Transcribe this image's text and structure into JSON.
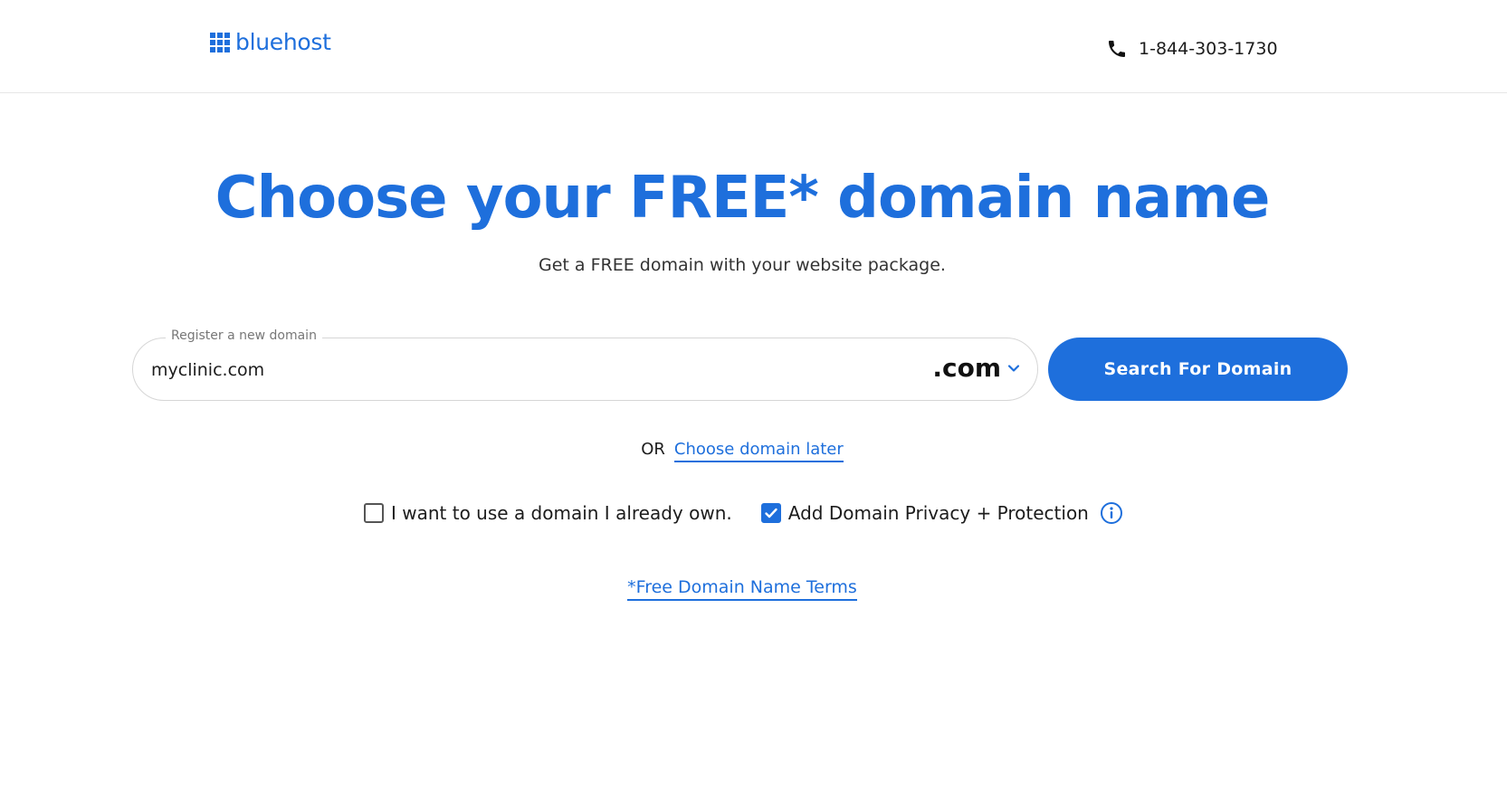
{
  "header": {
    "logo_text": "bluehost",
    "phone": "1-844-303-1730"
  },
  "hero": {
    "title": "Choose your FREE* domain name",
    "subtitle": "Get a FREE domain with your website package."
  },
  "domain_search": {
    "legend": "Register a new domain",
    "value": "myclinic.com",
    "tld": ".com",
    "button_label": "Search For Domain"
  },
  "alternate": {
    "or_text": "OR",
    "link_label": "Choose domain later"
  },
  "options": {
    "own_domain_label": "I want to use a domain I already own.",
    "own_domain_checked": false,
    "privacy_label": "Add Domain Privacy + Protection",
    "privacy_checked": true
  },
  "terms_link": "*Free Domain Name Terms",
  "colors": {
    "brand_blue": "#1e6fdc"
  }
}
